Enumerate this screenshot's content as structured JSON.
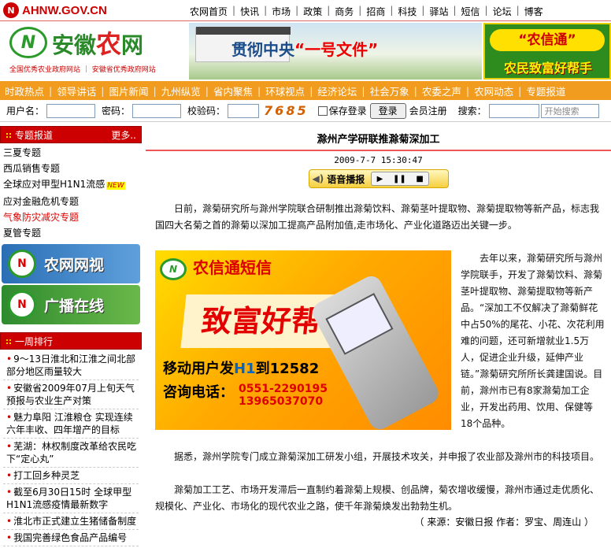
{
  "topbar": {
    "site_domain": "AHNW.GOV.CN",
    "nav": [
      "农网首页",
      "快讯",
      "市场",
      "政策",
      "商务",
      "招商",
      "科技",
      "驿站",
      "短信",
      "论坛",
      "博客"
    ]
  },
  "header": {
    "logo_name_pre": "安徽",
    "logo_name_nong": "农",
    "logo_name_post": "网",
    "logo_sub": "全国优秀农业政府网站 ｜ 安徽省优秀政府网站",
    "banner_slogan_pre": "贯彻中央",
    "banner_slogan_highlight": "“一号文件”",
    "ad_line1": "“农信通”",
    "ad_line2": "农民致富好帮手"
  },
  "catnav": [
    "时政热点",
    "领导讲话",
    "图片新闻",
    "九州纵览",
    "省内聚焦",
    "环球视点",
    "经济论坛",
    "社会万象",
    "农委之声",
    "农网动态",
    "专题报道"
  ],
  "login": {
    "username_label": "用户名：",
    "password_label": "密码：",
    "captcha_label": "校验码：",
    "captcha_value": "7685",
    "remember_label": "保存登录",
    "login_button": "登录",
    "register_label": "会员注册",
    "search_label": "搜索：",
    "search_placeholder": "开始搜索"
  },
  "sidebar": {
    "topics_title": "专题报道",
    "more": "更多..",
    "topics": [
      {
        "label": "三夏专题",
        "red": false
      },
      {
        "label": "西瓜销售专题",
        "red": false
      },
      {
        "label": "全球应对甲型H1N1流感",
        "red": false,
        "new": "NEW"
      },
      {
        "label": "应对金融危机专题",
        "red": false
      },
      {
        "label": "气象防灾减灾专题",
        "red": true
      },
      {
        "label": "夏管专题",
        "red": false
      }
    ],
    "tv_banner": "农网网视",
    "radio_banner": "广播在线",
    "rank_title": "一周排行",
    "rank": [
      "9～13日淮北和江淮之间北部部分地区雨量较大",
      "安徽省2009年07月上旬天气预报与农业生产对策",
      "魅力阜阳 江淮粮仓 实现连续六年丰收、四年增产的目标",
      "芜湖：林权制度改革给农民吃下“定心丸”",
      "打工回乡种灵芝",
      "截至6月30日15时 全球甲型H1N1流感疫情最新数字",
      "淮北市正式建立生猪储备制度",
      "我国完善绿色食品产品编号"
    ]
  },
  "article": {
    "title": "滁州产学研联推滁菊深加工",
    "date": "2009-7-7 15:30:47",
    "voice_label": "语音播报",
    "p1": "日前，滁菊研究所与滁州学院联合研制推出滁菊饮料、滁菊茎叶提取物、滁菊提取物等新产品，标志我国四大名菊之首的滁菊以深加工提高产品附加值,走市场化、产业化道路迈出关键一步。",
    "p2": "去年以来，滁菊研究所与滁州学院联手，开发了滁菊饮料、滁菊茎叶提取物、滁菊提取物等新产品。“深加工不仅解决了滁菊鲜花中占50%的尾花、小花、次花利用难的问题，还可新增就业1.5万人，促进企业升级，延伸产业链。”滁菊研究所所长龚建国说。目前，滁州市已有8家滁菊加工企业，开发出药用、饮用、保健等18个品种。",
    "p3": "据悉，滁州学院专门成立滁菊深加工研发小组，开展技术攻关，并申报了农业部及滁州市的科技项目。",
    "p4": "滁菊加工工艺、市场开发滞后一直制约着滁菊上规模、创品牌，菊农增收缓慢，滁州市通过走优质化、规模化、产业化、市场化的现代农业之路，使千年滁菊焕发出勃勃生机。",
    "source": "（ 来源：安徽日报  作者：罗宝、周连山 ）"
  },
  "sms_ad": {
    "name": "农信通短信",
    "tagline": "致富好帮手",
    "line1_pre": "移动用户发",
    "line1_code": "H1",
    "line1_post": "到12582",
    "line2": "咨询电话：",
    "phone1": "0551-2290195",
    "phone2": "13965037070"
  }
}
